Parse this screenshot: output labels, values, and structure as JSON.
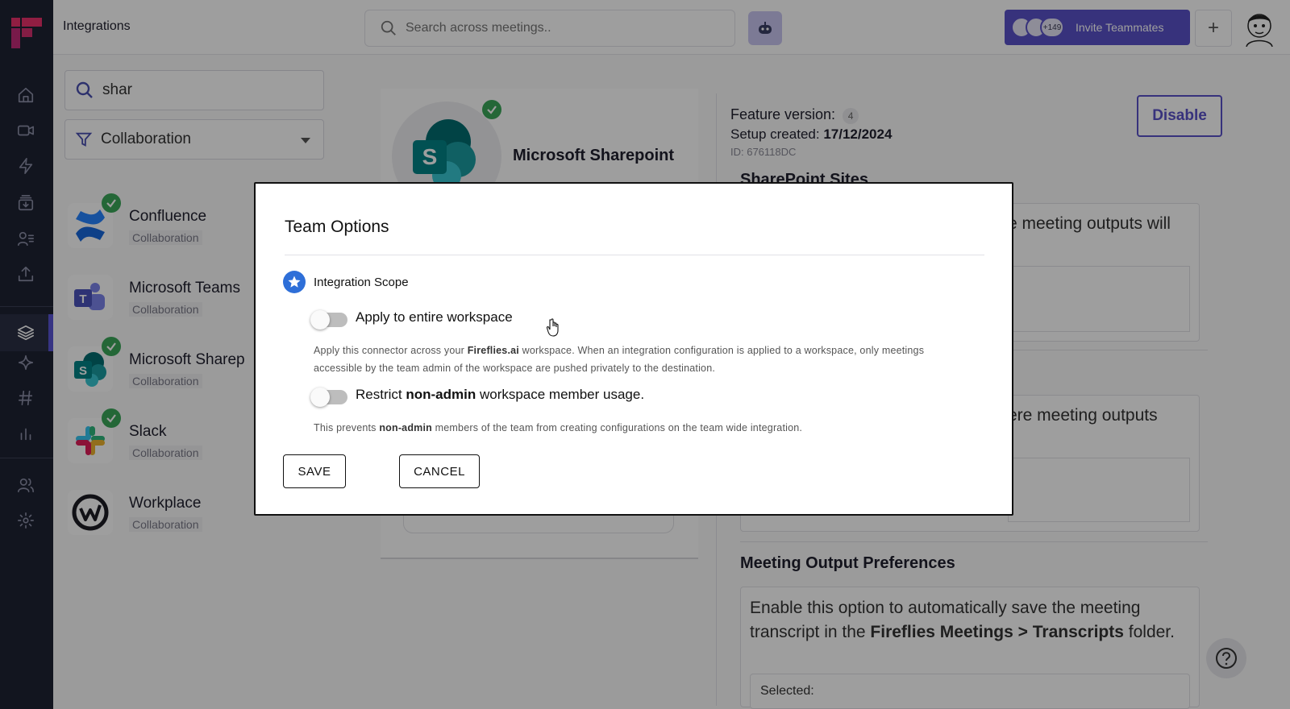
{
  "header": {
    "page_title": "Integrations",
    "search_placeholder": "Search across meetings..",
    "invite_label": "Invite Teammates",
    "invite_count": "+149"
  },
  "filters": {
    "search_value": "shar",
    "category_selected": "Collaboration"
  },
  "integrations": [
    {
      "name": "Confluence",
      "category": "Collaboration",
      "connected": true
    },
    {
      "name": "Microsoft Teams",
      "category": "Collaboration",
      "connected": false
    },
    {
      "name": "Microsoft Sharep",
      "category": "Collaboration",
      "connected": true
    },
    {
      "name": "Slack",
      "category": "Collaboration",
      "connected": true
    },
    {
      "name": "Workplace",
      "category": "Collaboration",
      "connected": false
    }
  ],
  "detail": {
    "name": "Microsoft Sharepoint",
    "feature_version_label": "Feature version:",
    "feature_version": "4",
    "setup_created_label": "Setup created:",
    "setup_created": "17/12/2024",
    "id_label": "ID: 676118DC",
    "disable_label": "Disable",
    "sites_heading": "SharePoint Sites",
    "box1_text": "e meeting outputs will",
    "box2_text": "ere meeting outputs",
    "output_pref_heading": "Meeting Output Preferences",
    "output_pref_text_1": "Enable this option to automatically save the meeting transcript in the ",
    "output_pref_text_bold": "Fireflies Meetings > Transcripts",
    "output_pref_text_2": " folder.",
    "selected_label": "Selected:"
  },
  "modal": {
    "title": "Team Options",
    "scope_label": "Integration Scope",
    "option1_label": "Apply to entire workspace",
    "option1_on": false,
    "option1_desc_1": "Apply this connector across your ",
    "option1_desc_bold": "Fireflies.ai",
    "option1_desc_2": " workspace. When an integration configuration is applied to a workspace, only meetings accessible by the team admin of the workspace are pushed privately to the destination.",
    "option2_label_1": "Restrict ",
    "option2_label_bold": "non-admin",
    "option2_label_2": " workspace member usage.",
    "option2_on": false,
    "option2_desc_1": "This prevents ",
    "option2_desc_bold": "non-admin",
    "option2_desc_2": " members of the team from creating configurations on the team wide integration.",
    "save_label": "SAVE",
    "cancel_label": "CANCEL"
  },
  "colors": {
    "sidebar": "#1e2233",
    "accent": "#5a52c9",
    "success": "#3aa65a",
    "scope_icon": "#2e6fd8"
  }
}
